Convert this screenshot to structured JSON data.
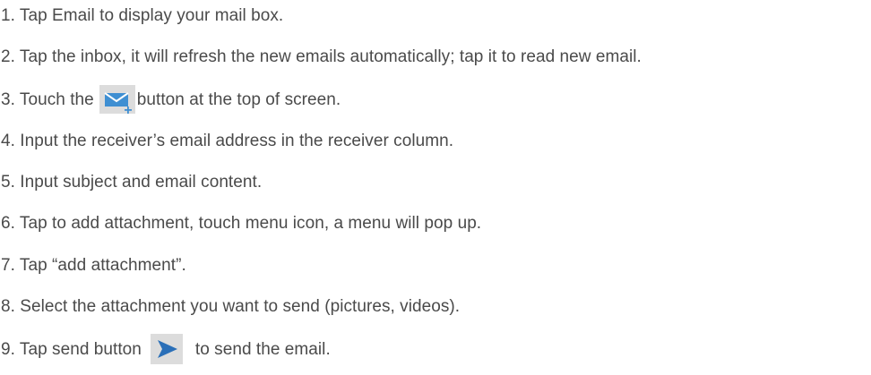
{
  "steps": [
    {
      "text": "1. Tap Email to display your mail box."
    },
    {
      "text": "2. Tap the inbox, it will refresh the new emails automatically; tap it to read new email."
    },
    {
      "before": "3. Touch the",
      "after": "button at the top of screen.",
      "icon": "compose-mail-icon"
    },
    {
      "text": "4. Input the receiver’s email address in the receiver column."
    },
    {
      "text": "5. Input subject and email content."
    },
    {
      "text": "6. Tap to add attachment, touch menu icon, a menu will pop up."
    },
    {
      "text": "7. Tap “add attachment”."
    },
    {
      "text": "8. Select the attachment you want to send (pictures, videos)."
    },
    {
      "before": "9. Tap send button",
      "after": "to send the email.",
      "icon": "send-icon"
    }
  ],
  "colors": {
    "text": "#4a4a4a",
    "icon_bg": "#dcdcdc",
    "compose_icon": "#3f8fd2",
    "send_icon": "#2a6fb8"
  }
}
